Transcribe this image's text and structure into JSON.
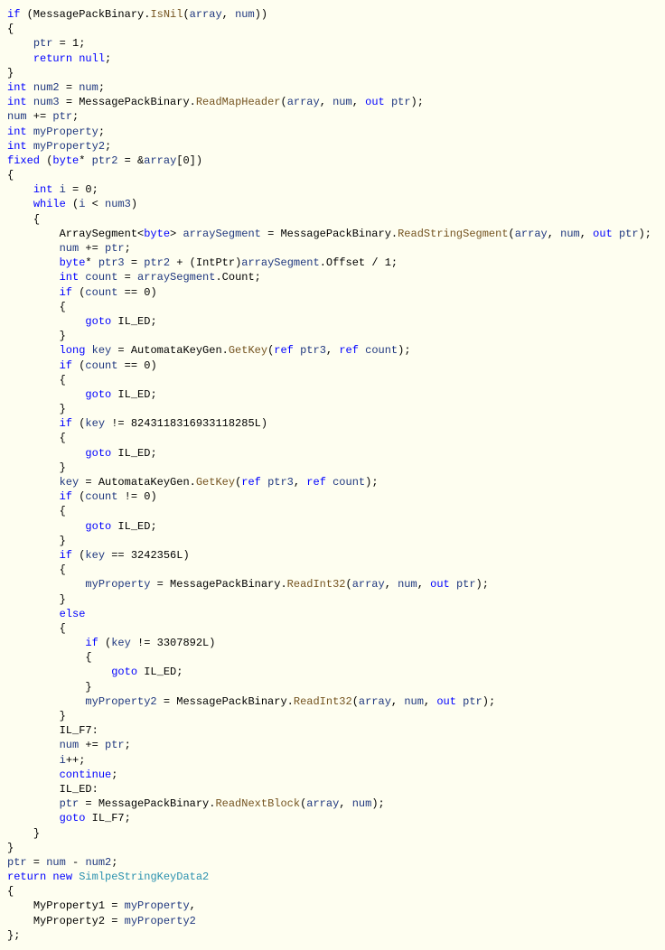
{
  "code": {
    "l01a": "if",
    "l01b": "IsNil",
    "l01c": "array",
    "l01d": "num",
    "l02": "{",
    "l03a": "ptr",
    "l03b": " = 1;",
    "l04a": "return",
    "l04b": "null",
    "l04c": ";",
    "l05": "}",
    "l06a": "int",
    "l06b": "num2",
    "l06c": " = ",
    "l06d": "num",
    "l06e": ";",
    "l07a": "int",
    "l07b": "num3",
    "l07c": " = MessagePackBinary.",
    "l07d": "ReadMapHeader",
    "l07e": "(",
    "l07f": "array",
    "l07g": ", ",
    "l07h": "num",
    "l07i": ", ",
    "l07j": "out",
    "l07k": "ptr",
    "l07l": ");",
    "l08a": "num",
    "l08b": " += ",
    "l08c": "ptr",
    "l08d": ";",
    "l09a": "int",
    "l09b": "myProperty",
    "l09c": ";",
    "l10a": "int",
    "l10b": "myProperty2",
    "l10c": ";",
    "l11a": "fixed",
    "l11b": " (",
    "l11c": "byte",
    "l11d": "* ",
    "l11e": "ptr2",
    "l11f": " = &",
    "l11g": "array",
    "l11h": "[0])",
    "l12": "{",
    "l13a": "int",
    "l13b": "i",
    "l13c": " = 0;",
    "l14a": "while",
    "l14b": " (",
    "l14c": "i",
    "l14d": " < ",
    "l14e": "num3",
    "l14f": ")",
    "l15": "{",
    "l16a": "ArraySegment<",
    "l16b": "byte",
    "l16c": "> ",
    "l16d": "arraySegment",
    "l16e": " = MessagePackBinary.",
    "l16f": "ReadStringSegment",
    "l16g": "(",
    "l16h": "array",
    "l16i": ", ",
    "l16j": "num",
    "l16k": ", ",
    "l16l": "out",
    "l16m": "ptr",
    "l16n": ");",
    "l17a": "num",
    "l17b": " += ",
    "l17c": "ptr",
    "l17d": ";",
    "l18a": "byte",
    "l18b": "* ",
    "l18c": "ptr3",
    "l18d": " = ",
    "l18e": "ptr2",
    "l18f": " + (IntPtr)",
    "l18g": "arraySegment",
    "l18h": ".Offset / 1;",
    "l19a": "int",
    "l19b": "count",
    "l19c": " = ",
    "l19d": "arraySegment",
    "l19e": ".Count;",
    "l20a": "if",
    "l20b": " (",
    "l20c": "count",
    "l20d": " == 0)",
    "l21": "{",
    "l22a": "goto",
    "l22b": " IL_ED;",
    "l23": "}",
    "l24a": "long",
    "l24b": "key",
    "l24c": " = AutomataKeyGen.",
    "l24d": "GetKey",
    "l24e": "(",
    "l24f": "ref",
    "l24g": "ptr3",
    "l24h": ", ",
    "l24i": "ref",
    "l24j": "count",
    "l24k": ");",
    "l25a": "if",
    "l25b": " (",
    "l25c": "count",
    "l25d": " == 0)",
    "l26": "{",
    "l27a": "goto",
    "l27b": " IL_ED;",
    "l28": "}",
    "l29a": "if",
    "l29b": " (",
    "l29c": "key",
    "l29d": " != 8243118316933118285L)",
    "l30": "{",
    "l31a": "goto",
    "l31b": " IL_ED;",
    "l32": "}",
    "l33a": "key",
    "l33b": " = AutomataKeyGen.",
    "l33c": "GetKey",
    "l33d": "(",
    "l33e": "ref",
    "l33f": "ptr3",
    "l33g": ", ",
    "l33h": "ref",
    "l33i": "count",
    "l33j": ");",
    "l34a": "if",
    "l34b": " (",
    "l34c": "count",
    "l34d": " != 0)",
    "l35": "{",
    "l36a": "goto",
    "l36b": " IL_ED;",
    "l37": "}",
    "l38a": "if",
    "l38b": " (",
    "l38c": "key",
    "l38d": " == 3242356L)",
    "l39": "{",
    "l40a": "myProperty",
    "l40b": " = MessagePackBinary.",
    "l40c": "ReadInt32",
    "l40d": "(",
    "l40e": "array",
    "l40f": ", ",
    "l40g": "num",
    "l40h": ", ",
    "l40i": "out",
    "l40j": "ptr",
    "l40k": ");",
    "l41": "}",
    "l42": "else",
    "l43": "{",
    "l44a": "if",
    "l44b": " (",
    "l44c": "key",
    "l44d": " != 3307892L)",
    "l45": "{",
    "l46a": "goto",
    "l46b": " IL_ED;",
    "l47": "}",
    "l48a": "myProperty2",
    "l48b": " = MessagePackBinary.",
    "l48c": "ReadInt32",
    "l48d": "(",
    "l48e": "array",
    "l48f": ", ",
    "l48g": "num",
    "l48h": ", ",
    "l48i": "out",
    "l48j": "ptr",
    "l48k": ");",
    "l49": "}",
    "l50": "IL_F7:",
    "l51a": "num",
    "l51b": " += ",
    "l51c": "ptr",
    "l51d": ";",
    "l52a": "i",
    "l52b": "++;",
    "l53a": "continue",
    "l53b": ";",
    "l54": "IL_ED:",
    "l55a": "ptr",
    "l55b": " = MessagePackBinary.",
    "l55c": "ReadNextBlock",
    "l55d": "(",
    "l55e": "array",
    "l55f": ", ",
    "l55g": "num",
    "l55h": ");",
    "l56a": "goto",
    "l56b": " IL_F7;",
    "l57": "}",
    "l58": "}",
    "l59a": "ptr",
    "l59b": " = ",
    "l59c": "num",
    "l59d": " - ",
    "l59e": "num2",
    "l59f": ";",
    "l60a": "return",
    "l60b": "new",
    "l60c": "SimlpeStringKeyData2",
    "l61": "{",
    "l62a": "MyProperty1 = ",
    "l62b": "myProperty",
    "l62c": ",",
    "l63a": "MyProperty2 = ",
    "l63b": "myProperty2",
    "l64": "};"
  }
}
